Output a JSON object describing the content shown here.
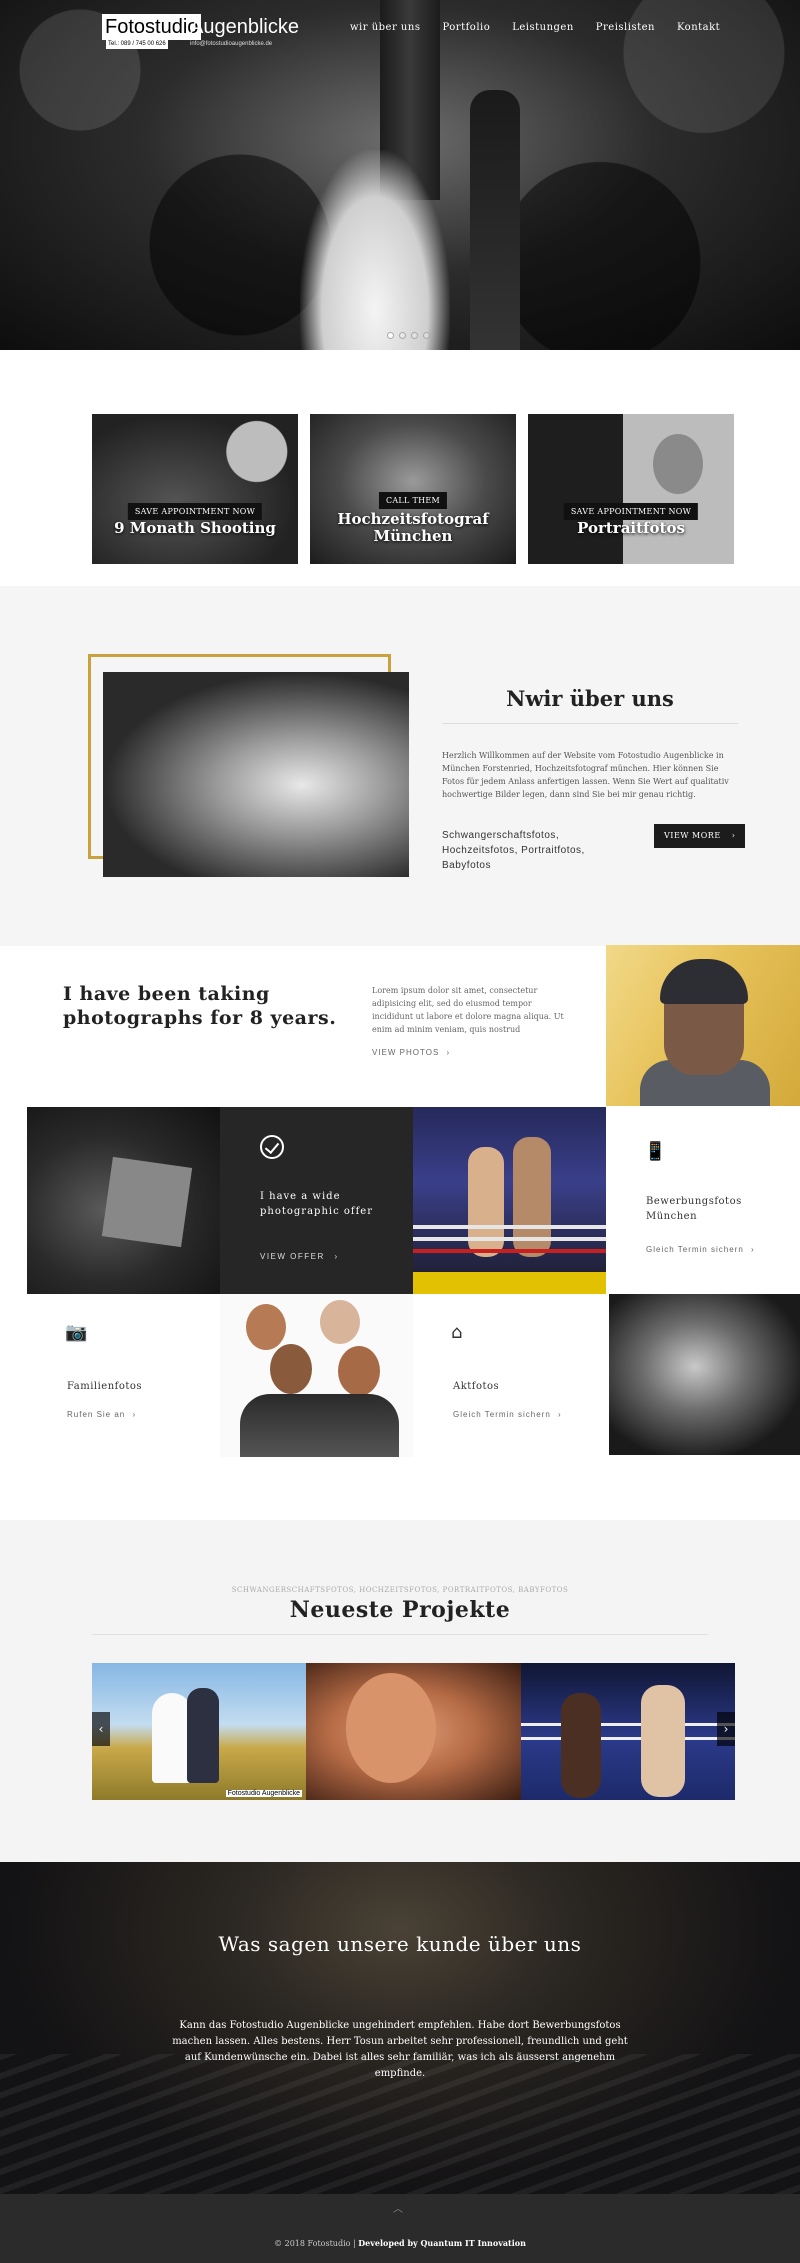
{
  "header": {
    "logo_word1": "Fotostudio",
    "logo_word2": "Augenblicke",
    "logo_phone": "Tel.: 089 / 745 00 626",
    "logo_email": "info@fotostudioaugenblicke.de",
    "nav": [
      "wir über uns",
      "Portfolio",
      "Leistungen",
      "Preislisten",
      "Kontakt"
    ]
  },
  "hero": {
    "slide_count": 4,
    "active_slide": 1
  },
  "tiles": [
    {
      "badge": "SAVE APPOINTMENT NOW",
      "title": "9 Monath Shooting"
    },
    {
      "badge": "CALL THEM",
      "title": "Hochzeitsfotograf München"
    },
    {
      "badge": "SAVE APPOINTMENT NOW",
      "title": "Portraitfotos"
    }
  ],
  "about": {
    "heading": "Nwir über uns",
    "body": "Herzlich Willkommen auf der Website vom Fotostudio Augenblicke in München Forstenried, Hochzeitsfotograf münchen. Hier können Sie Fotos für jedem Anlass anfertigen lassen. Wenn Sie Wert auf qualitativ hochwertige Bilder legen, dann sind Sie bei mir genau richtig.",
    "tags": "Schwangerschaftsfotos, Hochzeitsfotos, Portraitfotos, Babyfotos",
    "button": "VIEW MORE"
  },
  "intro": {
    "title": "I have been taking photographs for 8 years.",
    "body": "Lorem ipsum dolor sit amet, consectetur adipisicing elit, sed do eiusmod tempor incididunt ut labore et dolore magna aliqua. Ut enim ad minim veniam, quis nostrud",
    "link": "VIEW PHOTOS"
  },
  "offer": {
    "title": "I have a wide photographic offer",
    "link": "VIEW OFFER"
  },
  "services": [
    {
      "title": "Bewerbungsfotos München",
      "link": "Gleich Termin sichern"
    },
    {
      "title": "Familienfotos",
      "link": "Rufen Sie an"
    },
    {
      "title": "Aktfotos",
      "link": "Gleich Termin sichern"
    }
  ],
  "projects": {
    "subtitle": "SCHWANGERSCHAFTSFOTOS, HOCHZEITSFOTOS, PORTRAITFOTOS, BABYFOTOS",
    "heading": "Neueste Projekte",
    "watermark": "Fotostudio Augenblicke"
  },
  "testimonial": {
    "heading": "Was sagen unsere kunde über uns",
    "quote": "Kann das Fotostudio Augenblicke ungehindert empfehlen. Habe dort Bewerbungsfotos machen lassen. Alles bestens. Herr Tosun arbeitet sehr professionell, freundlich und geht auf Kundenwünsche ein. Dabei ist alles sehr familiär, was ich als äusserst angenehm empfinde."
  },
  "footer": {
    "copyright": "© 2018 Fotostudio | ",
    "developer": "Developed by Quantum IT Innovation"
  },
  "icons": {
    "chevron": "›",
    "prev": "‹",
    "next": "›",
    "up": "︿",
    "phone": "📱",
    "camera": "📷",
    "tripod": "⌂"
  }
}
